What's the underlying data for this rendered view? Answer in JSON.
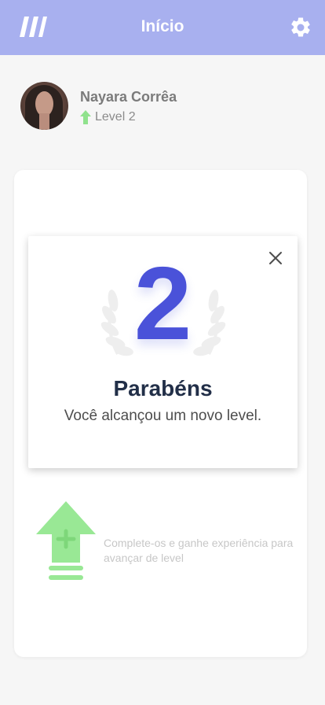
{
  "header": {
    "title": "Início",
    "logo_icon": "app-logo-icon",
    "settings_icon": "gear-icon"
  },
  "profile": {
    "name": "Nayara Corrêa",
    "level_label": "Level 2"
  },
  "card": {
    "hint_text": "Complete-os e ganhe experiência para avançar de level"
  },
  "modal": {
    "level_number": "2",
    "title": "Parabéns",
    "subtitle": "Você alcançou um novo level.",
    "close_icon": "close-icon"
  },
  "colors": {
    "header_bg": "#a8b0ef",
    "accent_blue": "#4a52d9",
    "green": "#90e28d",
    "text_dark": "#222f48"
  }
}
